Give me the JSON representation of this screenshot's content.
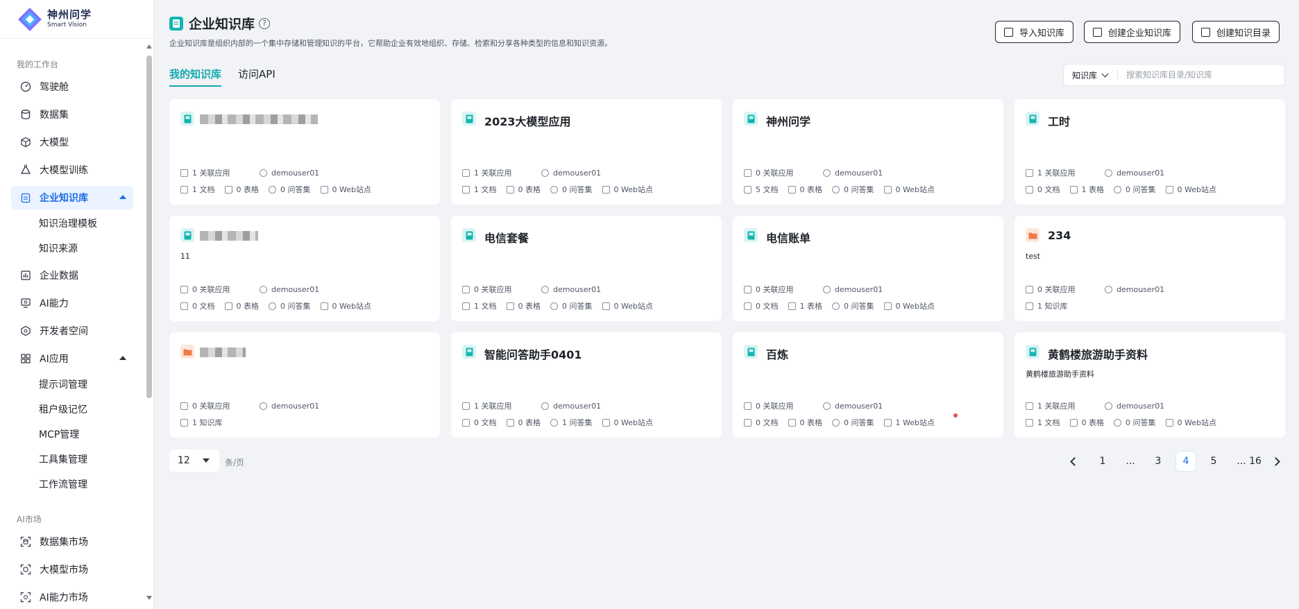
{
  "brand": {
    "name_cn": "神州问学",
    "name_en": "Smart Vision"
  },
  "sidebar": {
    "group_workspace": "我的工作台",
    "group_market": "AI市场",
    "items": {
      "cockpit": "驾驶舱",
      "datasets": "数据集",
      "models": "大模型",
      "training": "大模型训练",
      "kb": "企业知识库",
      "kb_template": "知识治理模板",
      "kb_source": "知识来源",
      "enterprise_data": "企业数据",
      "ai_ability": "AI能力",
      "dev_space": "开发者空间",
      "ai_app": "AI应用",
      "prompt": "提示词管理",
      "memory": "租户级记忆",
      "mcp": "MCP管理",
      "toolset": "工具集管理",
      "workflow": "工作流管理",
      "dataset_market": "数据集市场",
      "model_market": "大模型市场",
      "ability_market": "AI能力市场"
    }
  },
  "header": {
    "title": "企业知识库",
    "description": "企业知识库是组织内部的一个集中存储和管理知识的平台，它帮助企业有效地组织、存储、检索和分享各种类型的信息和知识资源。",
    "buttons": {
      "import": "导入知识库",
      "create_kb": "创建企业知识库",
      "create_dir": "创建知识目录"
    }
  },
  "tabs": {
    "mine": "我的知识库",
    "api": "访问API"
  },
  "search": {
    "type": "知识库",
    "placeholder": "搜索知识库目录/知识库"
  },
  "labels": {
    "linked": "关联应用",
    "docs": "文档",
    "tables": "表格",
    "qa": "问答集",
    "web": "Web站点",
    "kbs": "知识库"
  },
  "cards": [
    {
      "title": "",
      "desc": "",
      "icon": "book",
      "linked": "1 关联应用",
      "owner": "demouser01",
      "docs": "1 文档",
      "tables": "0 表格",
      "qa": "0 问答集",
      "web": "0 Web站点"
    },
    {
      "title": "2023大模型应用",
      "desc": "",
      "icon": "book",
      "linked": "1 关联应用",
      "owner": "demouser01",
      "docs": "1 文档",
      "tables": "0 表格",
      "qa": "0 问答集",
      "web": "0 Web站点"
    },
    {
      "title": "神州问学",
      "desc": "",
      "icon": "book",
      "linked": "0 关联应用",
      "owner": "demouser01",
      "docs": "5 文档",
      "tables": "0 表格",
      "qa": "0 问答集",
      "web": "0 Web站点"
    },
    {
      "title": "工时",
      "desc": "",
      "icon": "book",
      "linked": "1 关联应用",
      "owner": "demouser01",
      "docs": "0 文档",
      "tables": "1 表格",
      "qa": "0 问答集",
      "web": "0 Web站点"
    },
    {
      "title": "",
      "desc": "11",
      "icon": "book",
      "linked": "0 关联应用",
      "owner": "demouser01",
      "docs": "0 文档",
      "tables": "0 表格",
      "qa": "0 问答集",
      "web": "0 Web站点"
    },
    {
      "title": "电信套餐",
      "desc": "",
      "icon": "book",
      "linked": "0 关联应用",
      "owner": "demouser01",
      "docs": "1 文档",
      "tables": "0 表格",
      "qa": "0 问答集",
      "web": "0 Web站点"
    },
    {
      "title": "电信账单",
      "desc": "",
      "icon": "book",
      "linked": "0 关联应用",
      "owner": "demouser01",
      "docs": "0 文档",
      "tables": "1 表格",
      "qa": "0 问答集",
      "web": "0 Web站点"
    },
    {
      "title": "234",
      "desc": "test",
      "icon": "folder",
      "linked": "0 关联应用",
      "owner": "demouser01",
      "kbs": "1 知识库"
    },
    {
      "title": "",
      "desc": "",
      "icon": "folder",
      "linked": "0 关联应用",
      "owner": "demouser01",
      "kbs": "1 知识库"
    },
    {
      "title": "智能问答助手0401",
      "desc": "",
      "icon": "book",
      "linked": "1 关联应用",
      "owner": "demouser01",
      "docs": "0 文档",
      "tables": "0 表格",
      "qa": "1 问答集",
      "web": "0 Web站点"
    },
    {
      "title": "百炼",
      "desc": "",
      "icon": "book",
      "linked": "0 关联应用",
      "owner": "demouser01",
      "docs": "0 文档",
      "tables": "0 表格",
      "qa": "0 问答集",
      "web": "1 Web站点"
    },
    {
      "title": "黄鹤楼旅游助手资料",
      "desc": "黄鹤楼旅游助手资料",
      "icon": "book",
      "linked": "1 关联应用",
      "owner": "demouser01",
      "docs": "1 文档",
      "tables": "0 表格",
      "qa": "0 问答集",
      "web": "0 Web站点"
    }
  ],
  "pagination": {
    "page_size": "12",
    "unit": "条/页",
    "pages": [
      "1",
      "...",
      "3",
      "4",
      "5",
      "...",
      "16"
    ],
    "current": "4"
  },
  "colors": {
    "accent": "#12a8b0",
    "active_blue": "#1c6de6",
    "folder": "#f07a42"
  }
}
